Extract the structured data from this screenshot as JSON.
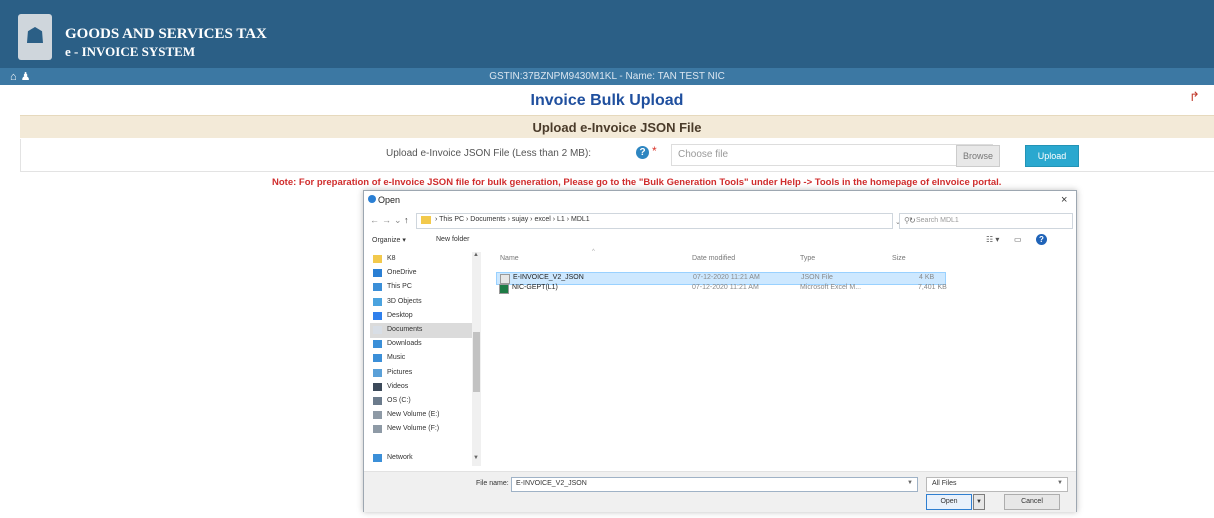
{
  "header": {
    "site_line1": "GOODS AND SERVICES TAX",
    "site_line2": "e - INVOICE SYSTEM",
    "emblem_icon": "national-emblem",
    "accent": "#2b5f86"
  },
  "subbar": {
    "gstin_text": "GSTIN:37BZNPM9430M1KL - Name: TAN TEST NIC",
    "home_icon": "home-icon",
    "user_icon": "user-icon"
  },
  "page": {
    "title": "Invoice Bulk Upload",
    "section_title": "Upload e-Invoice JSON File",
    "upload_label": "Upload e-Invoice JSON File (Less than 2 MB):",
    "required_mark": "*",
    "file_placeholder": "Choose file",
    "browse_label": "Browse",
    "upload_label_btn": "Upload",
    "note": "Note: For preparation of e-Invoice JSON file for bulk generation, Please go to the \"Bulk Generation Tools\" under Help -> Tools in the homepage of eInvoice portal."
  },
  "dialog": {
    "title": "Open",
    "close": "×",
    "breadcrumb": "›  This PC  ›  Documents  ›  sujay  ›  excel  ›  L1  ›  MDL1",
    "search_placeholder": "Search MDL1",
    "organize": "Organize ▾",
    "new_folder": "New folder",
    "nav_items": [
      {
        "label": "K8",
        "icon": "folder-icon",
        "color": "#f2c94c"
      },
      {
        "label": "OneDrive",
        "icon": "cloud-icon",
        "color": "#2a7fd4"
      },
      {
        "label": "This PC",
        "icon": "computer-icon",
        "color": "#3b8fd8"
      },
      {
        "label": "3D Objects",
        "icon": "cube-icon",
        "color": "#4aa3df"
      },
      {
        "label": "Desktop",
        "icon": "desktop-icon",
        "color": "#2f80ed"
      },
      {
        "label": "Documents",
        "icon": "documents-icon",
        "color": "#d8dee6",
        "selected": true
      },
      {
        "label": "Downloads",
        "icon": "download-icon",
        "color": "#3b8fd8"
      },
      {
        "label": "Music",
        "icon": "music-icon",
        "color": "#3b8fd8"
      },
      {
        "label": "Pictures",
        "icon": "pictures-icon",
        "color": "#5aa0d8"
      },
      {
        "label": "Videos",
        "icon": "video-icon",
        "color": "#3c4a5a"
      },
      {
        "label": "OS (C:)",
        "icon": "drive-icon",
        "color": "#6b7b8c"
      },
      {
        "label": "New Volume (E:)",
        "icon": "drive-icon",
        "color": "#8e9aa6"
      },
      {
        "label": "New Volume (F:)",
        "icon": "drive-icon",
        "color": "#8e9aa6"
      },
      {
        "label": "",
        "icon": "",
        "color": "transparent"
      },
      {
        "label": "Network",
        "icon": "network-icon",
        "color": "#3b8fd8"
      }
    ],
    "columns": [
      "Name",
      "Date modified",
      "Type",
      "Size"
    ],
    "files": [
      {
        "name": "E-INVOICE_V2_JSON",
        "date": "07-12-2020 11:21 AM",
        "type": "JSON File",
        "size": "4 KB",
        "icon": "json-file-icon",
        "selected": true
      },
      {
        "name": "NIC-GEPT(L1)",
        "date": "07-12-2020 11:21 AM",
        "type": "Microsoft Excel M...",
        "size": "7,401 KB",
        "icon": "excel-file-icon",
        "selected": false
      }
    ],
    "file_name_label": "File name:",
    "file_name_value": "E-INVOICE_V2_JSON",
    "file_type": "All Files",
    "open_label": "Open",
    "cancel_label": "Cancel"
  }
}
